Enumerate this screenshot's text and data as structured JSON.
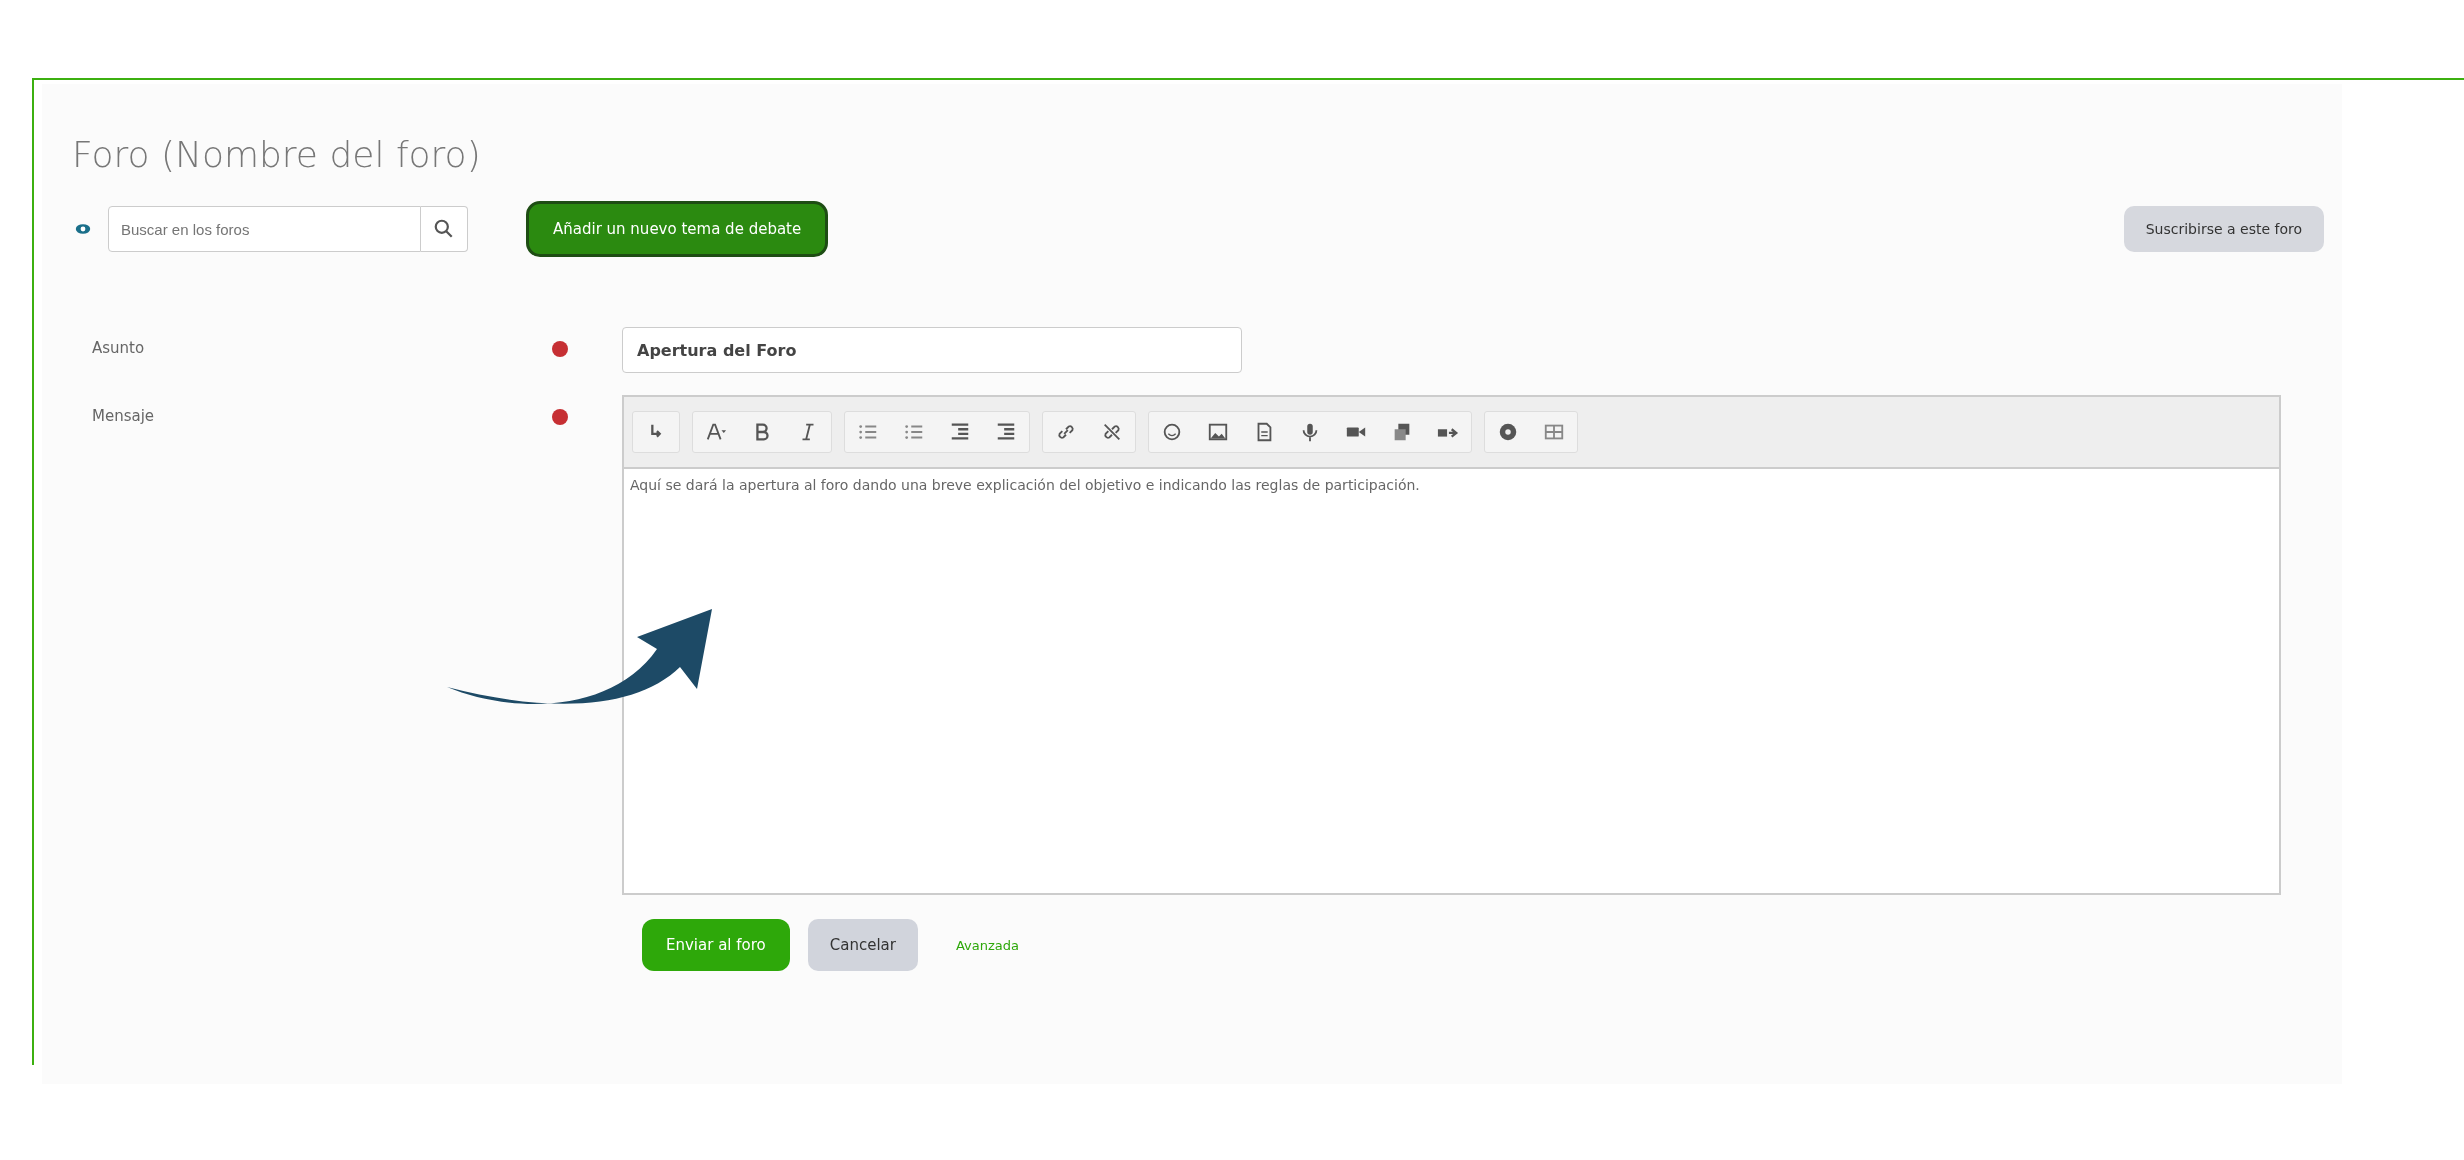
{
  "title": "Foro (Nombre del foro)",
  "search": {
    "placeholder": "Buscar en los foros"
  },
  "add_button": "Añadir un nuevo tema de debate",
  "subscribe_button": "Suscribirse a este foro",
  "fields": [
    {
      "label": "Asunto",
      "required": true,
      "kind": "text",
      "value": "Apertura del Foro"
    },
    {
      "label": "Mensaje",
      "required": true,
      "kind": "editor",
      "value": "Aquí se dará la apertura al foro dando una breve explicación del objetivo e indicando las reglas de participación."
    }
  ],
  "buttons": [
    {
      "label": "Enviar al foro",
      "kind": "primary"
    },
    {
      "label": "Cancelar",
      "kind": "secondary"
    },
    {
      "label": "Avanzada",
      "kind": "link"
    }
  ]
}
